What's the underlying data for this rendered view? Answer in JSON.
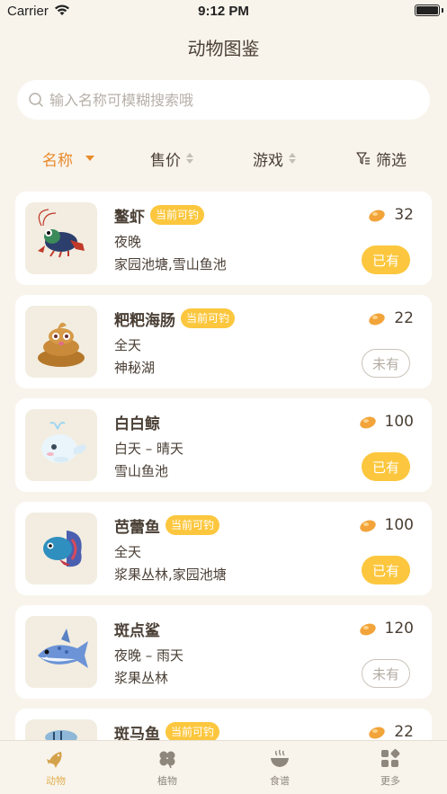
{
  "status": {
    "carrier": "Carrier",
    "time": "9:12 PM"
  },
  "nav": {
    "title": "动物图鉴"
  },
  "search": {
    "placeholder": "输入名称可模糊搜索哦"
  },
  "sort": {
    "name": "名称",
    "price": "售价",
    "game": "游戏",
    "filter": "筛选"
  },
  "animals": [
    {
      "name": "鳌虾",
      "badge": "当前可钓",
      "time": "夜晚",
      "location": "家园池塘,雪山鱼池",
      "price": "32",
      "status": "已有",
      "owned": true,
      "icon": "crayfish"
    },
    {
      "name": "粑粑海肠",
      "badge": "当前可钓",
      "time": "全天",
      "location": "神秘湖",
      "price": "22",
      "status": "未有",
      "owned": false,
      "icon": "poop-worm"
    },
    {
      "name": "白白鲸",
      "badge": "",
      "time": "白天 – 晴天",
      "location": "雪山鱼池",
      "price": "100",
      "status": "已有",
      "owned": true,
      "icon": "beluga"
    },
    {
      "name": "芭蕾鱼",
      "badge": "当前可钓",
      "time": "全天",
      "location": "浆果丛林,家园池塘",
      "price": "100",
      "status": "已有",
      "owned": true,
      "icon": "betta-fish"
    },
    {
      "name": "斑点鲨",
      "badge": "",
      "time": "夜晚 – 雨天",
      "location": "浆果丛林",
      "price": "120",
      "status": "未有",
      "owned": false,
      "icon": "spotted-shark"
    },
    {
      "name": "斑马鱼",
      "badge": "当前可钓",
      "time": "",
      "location": "",
      "price": "22",
      "status": "",
      "owned": false,
      "icon": "zebra-fish"
    }
  ],
  "tabs": [
    {
      "label": "动物",
      "icon": "fish-icon",
      "active": true
    },
    {
      "label": "植物",
      "icon": "clover-icon",
      "active": false
    },
    {
      "label": "食谱",
      "icon": "bowl-icon",
      "active": false
    },
    {
      "label": "更多",
      "icon": "grid-icon",
      "active": false
    }
  ],
  "colors": {
    "accent": "#e98a2b",
    "badge": "#fcc73e",
    "background": "#f8f4ec"
  }
}
